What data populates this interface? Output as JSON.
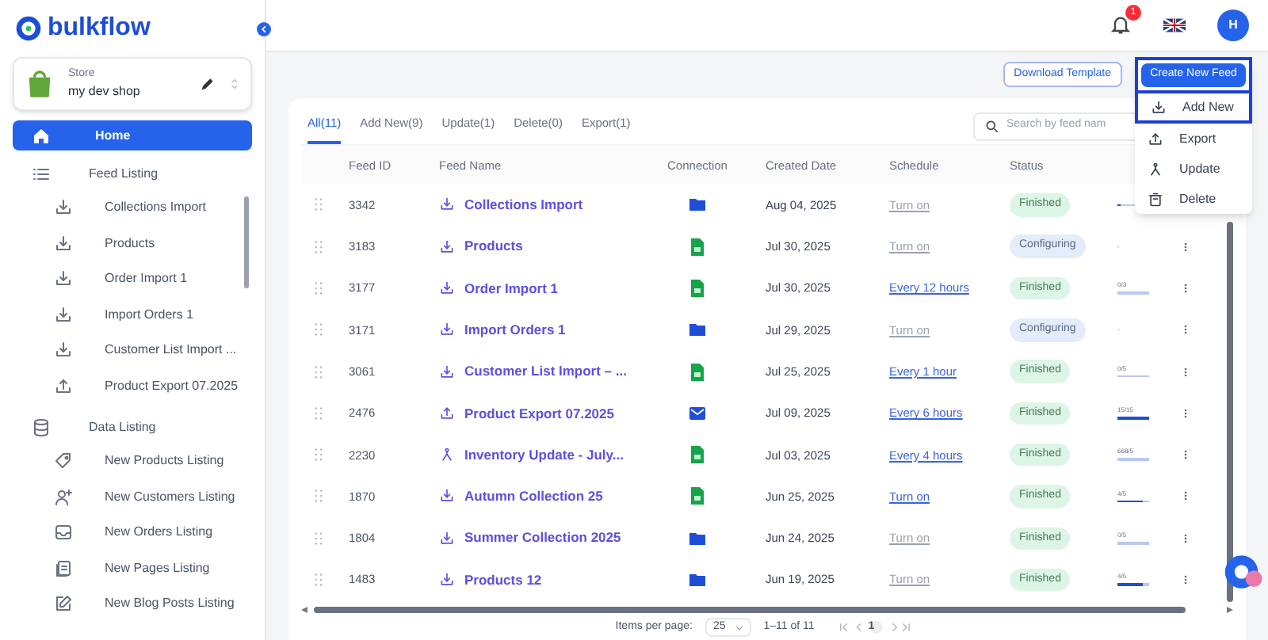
{
  "brand": {
    "name": "bulkflow"
  },
  "store": {
    "label": "Store",
    "name": "my dev shop"
  },
  "nav": [
    {
      "kind": "home",
      "label": "Home",
      "selected": true
    },
    {
      "kind": "section",
      "label": "Feed Listing",
      "children": [
        {
          "label": "Collections Import"
        },
        {
          "label": "Products"
        },
        {
          "label": "Order Import 1"
        },
        {
          "label": "Import Orders 1"
        },
        {
          "label": "Customer List Import ..."
        },
        {
          "label": "Product Export 07.2025"
        }
      ]
    },
    {
      "kind": "section",
      "label": "Data Listing",
      "children": [
        {
          "label": "New Products Listing"
        },
        {
          "label": "New Customers Listing"
        },
        {
          "label": "New Orders Listing"
        },
        {
          "label": "New Pages Listing"
        },
        {
          "label": "New Blog Posts Listing"
        }
      ]
    }
  ],
  "header": {
    "notifications": "1",
    "avatar": "H"
  },
  "actions": {
    "download": "Download Template",
    "create": "Create New Feed"
  },
  "menu": [
    {
      "label": "Add New",
      "selected": true
    },
    {
      "label": "Export",
      "selected": false
    },
    {
      "label": "Update",
      "selected": false
    },
    {
      "label": "Delete",
      "selected": false
    }
  ],
  "tabs": [
    {
      "label": "All(11)",
      "selected": true
    },
    {
      "label": "Add New(9)",
      "selected": false
    },
    {
      "label": "Update(1)",
      "selected": false
    },
    {
      "label": "Delete(0)",
      "selected": false
    },
    {
      "label": "Export(1)",
      "selected": false
    }
  ],
  "search": {
    "placeholder": "Search by feed nam"
  },
  "table": {
    "columns": [
      "Feed ID",
      "Feed Name",
      "Connection",
      "Created Date",
      "Schedule",
      "Status"
    ],
    "rows": [
      {
        "id": "3342",
        "name": "Collections Import",
        "date": "Aug 04, 2025",
        "schedule": "Turn on",
        "schedule_active": false,
        "status": {
          "label": "Finished",
          "kind": "finished"
        },
        "level": 0.1
      },
      {
        "id": "3183",
        "name": "Products",
        "date": "Jul 30, 2025",
        "schedule": "Turn on",
        "schedule_active": false,
        "status": {
          "label": "Configuring",
          "kind": "configuring"
        },
        "progress": "-"
      },
      {
        "id": "3177",
        "name": "Order Import 1",
        "date": "Jul 30, 2025",
        "schedule": "Every 12 hours",
        "schedule_active": true,
        "status": {
          "label": "Finished",
          "kind": "finished"
        },
        "progress": "0/3",
        "level": 0
      },
      {
        "id": "3171",
        "name": "Import Orders 1",
        "date": "Jul 29, 2025",
        "schedule": "Turn on",
        "schedule_active": false,
        "status": {
          "label": "Configuring",
          "kind": "configuring"
        },
        "progress": "-"
      },
      {
        "id": "3061",
        "name": "Customer List Import – ...",
        "date": "Jul 25, 2025",
        "schedule": "Every 1 hour",
        "schedule_active": true,
        "status": {
          "label": "Finished",
          "kind": "finished"
        },
        "progress": "0/5",
        "level": 0
      },
      {
        "id": "2476",
        "name": "Product Export 07.2025",
        "date": "Jul 09, 2025",
        "schedule": "Every 6 hours",
        "schedule_active": true,
        "status": {
          "label": "Finished",
          "kind": "finished"
        },
        "progress": "15/15",
        "level": 1
      },
      {
        "id": "2230",
        "name": "Inventory Update - July...",
        "date": "Jul 03, 2025",
        "schedule": "Every 4 hours",
        "schedule_active": true,
        "status": {
          "label": "Finished",
          "kind": "finished"
        },
        "progress": "668/5",
        "level": 0
      },
      {
        "id": "1870",
        "name": "Autumn Collection 25",
        "date": "Jun 25, 2025",
        "schedule": "Turn on",
        "schedule_active": true,
        "status": {
          "label": "Finished",
          "kind": "finished"
        },
        "progress": "4/5",
        "level": 0.8
      },
      {
        "id": "1804",
        "name": "Summer Collection 2025",
        "date": "Jun 24, 2025",
        "schedule": "Turn on",
        "schedule_active": false,
        "status": {
          "label": "Finished",
          "kind": "finished"
        },
        "progress": "0/5",
        "level": 0
      },
      {
        "id": "1483",
        "name": "Products 12",
        "date": "Jun 19, 2025",
        "schedule": "Turn on",
        "schedule_active": false,
        "status": {
          "label": "Finished",
          "kind": "finished"
        },
        "progress": "4/5",
        "level": 0.8
      }
    ]
  },
  "pagination": {
    "label": "Items per page:",
    "per_page": "25",
    "range": "1–11 of 11",
    "page": "1"
  }
}
